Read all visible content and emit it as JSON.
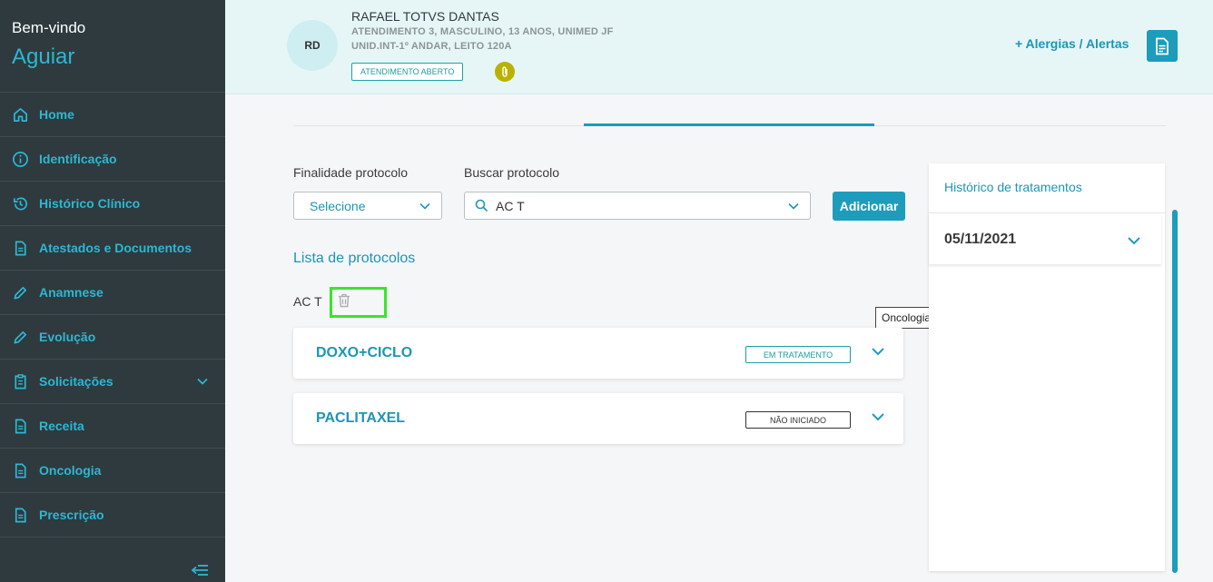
{
  "sidebar": {
    "welcome": "Bem-vindo",
    "user": "Aguiar",
    "items": [
      {
        "label": "Home",
        "icon": "home-icon"
      },
      {
        "label": "Identificação",
        "icon": "info-icon"
      },
      {
        "label": "Histórico Clínico",
        "icon": "history-icon"
      },
      {
        "label": "Atestados e Documentos",
        "icon": "document-icon"
      },
      {
        "label": "Anamnese",
        "icon": "pencil-icon"
      },
      {
        "label": "Evolução",
        "icon": "pencil-icon"
      },
      {
        "label": "Solicitações",
        "icon": "clipboard-icon"
      },
      {
        "label": "Receita",
        "icon": "document-icon"
      },
      {
        "label": "Oncologia",
        "icon": "document-icon"
      },
      {
        "label": "Prescrição",
        "icon": "document-icon"
      }
    ]
  },
  "patient": {
    "initials": "RD",
    "name": "RAFAEL TOTVS DANTAS",
    "info_line1": "ATENDIMENTO 3, MASCULINO, 13 ANOS, UNIMED JF",
    "info_line2": "UNID.INT-1º ANDAR, LEITO 120A",
    "status": "ATENDIMENTO ABERTO"
  },
  "header": {
    "alerts_link": "+ Alergias / Alertas"
  },
  "form": {
    "finalidade_label": "Finalidade protocolo",
    "finalidade_value": "Selecione",
    "buscar_label": "Buscar protocolo",
    "buscar_value": "AC T",
    "add_button": "Adicionar"
  },
  "protocol_list": {
    "title": "Lista de protocolos",
    "group_name": "AC T",
    "items": [
      {
        "name": "DOXO+CICLO",
        "status": "EM TRATAMENTO",
        "status_color": "#1a9e9e"
      },
      {
        "name": "PACLITAXEL",
        "status": "NÃO INICIADO",
        "status_color": "#333333"
      }
    ]
  },
  "tooltip": "Oncologia",
  "history": {
    "title": "Histórico de tratamentos",
    "dates": [
      "05/11/2021"
    ]
  },
  "colors": {
    "accent": "#1e9cbb",
    "sidebar_bg": "#2e3a3d",
    "highlight": "#39e52a"
  }
}
